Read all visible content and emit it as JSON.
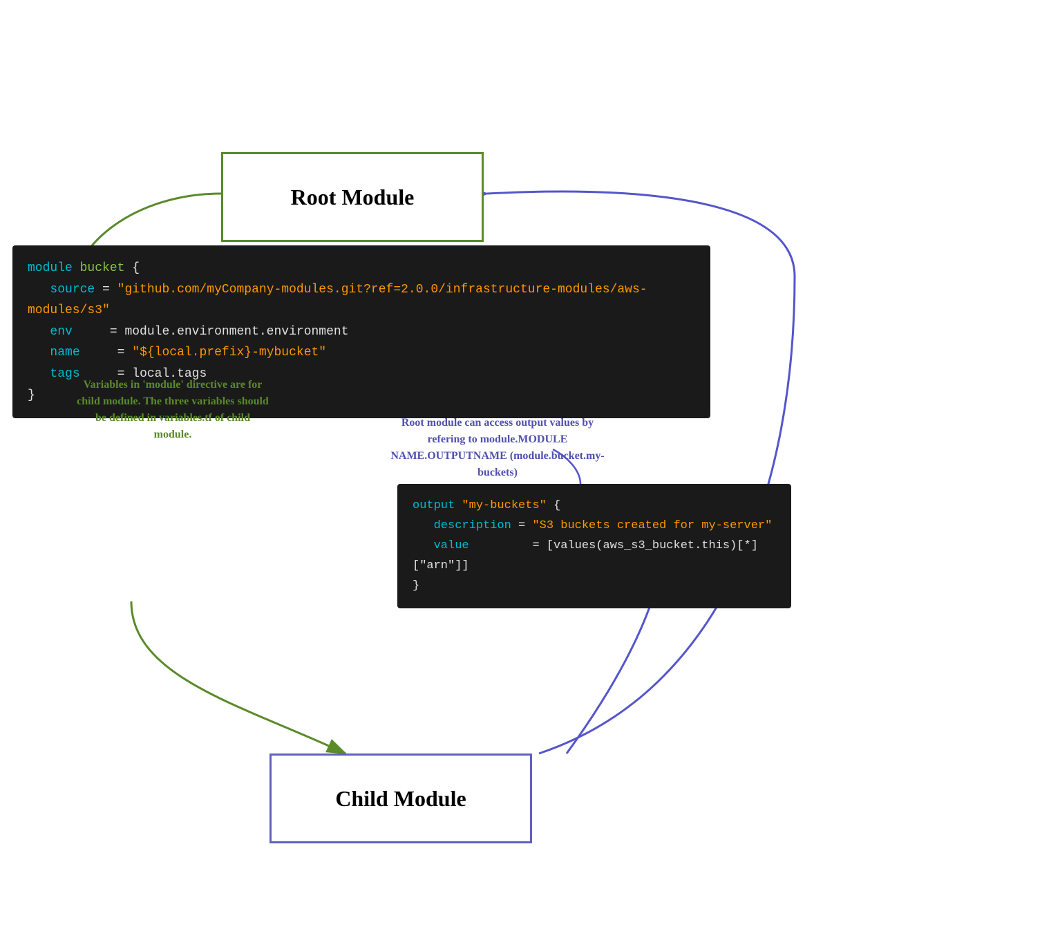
{
  "root_module": {
    "label": "Root\nModule"
  },
  "child_module": {
    "label": "Child\nModule"
  },
  "code_top": {
    "line1_kw": "module",
    "line1_name": "bucket",
    "line1_brace": "{",
    "line2_key": "source",
    "line2_eq": "=",
    "line2_val": "\"github.com/myCompany-modules.git?ref=2.0.0/infrastructure-modules/aws-modules/s3\"",
    "line3_key": "env",
    "line3_eq": "=",
    "line3_val": "module.environment.environment",
    "line4_key": "name",
    "line4_eq": "=",
    "line4_val": "\"${local.prefix}-mybucket\"",
    "line5_key": "tags",
    "line5_eq": "=",
    "line5_val": "local.tags",
    "line6_close": "}"
  },
  "code_output": {
    "line1_kw": "output",
    "line1_name": "\"my-buckets\"",
    "line1_brace": "{",
    "line2_key": "description",
    "line2_eq": "=",
    "line2_val": "\"S3 buckets created for my-server\"",
    "line3_key": "value",
    "line3_eq": "=",
    "line3_val": "[values(aws_s3_bucket.this)[*][\"arn\"]]",
    "line4_close": "}"
  },
  "annotation_left": "Variables in 'module' directive are for child module. The three variables should be defined in variables.tf of child module.",
  "annotation_right": "Root module can access output values by refering to module.MODULE NAME.OUTPUTNAME (module.bucket.my-buckets)"
}
